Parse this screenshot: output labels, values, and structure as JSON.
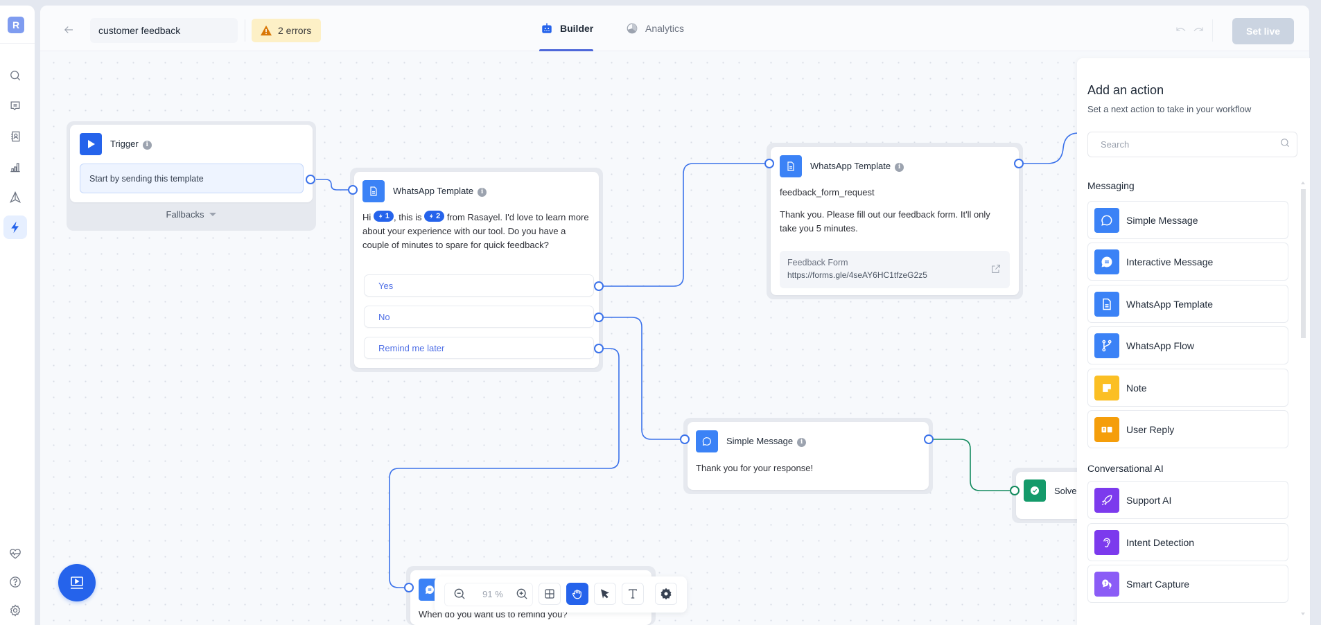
{
  "app": {
    "logo_letter": "R"
  },
  "rail": {
    "items": [
      {
        "name": "search",
        "icon": "search-icon"
      },
      {
        "name": "conversations",
        "icon": "message-square-icon"
      },
      {
        "name": "contacts",
        "icon": "contact-book-icon"
      },
      {
        "name": "reports",
        "icon": "bar-chart-icon"
      },
      {
        "name": "campaigns",
        "icon": "send-icon"
      },
      {
        "name": "automations",
        "icon": "lightning-icon",
        "active": true
      }
    ],
    "bottom_items": [
      {
        "name": "health",
        "icon": "heart-pulse-icon"
      },
      {
        "name": "help",
        "icon": "help-circle-icon"
      },
      {
        "name": "settings",
        "icon": "gear-icon"
      }
    ]
  },
  "header": {
    "workflow_name": "customer feedback",
    "errors_label": "2 errors",
    "tabs": [
      {
        "label": "Builder",
        "active": true
      },
      {
        "label": "Analytics",
        "active": false
      }
    ],
    "set_live_label": "Set live"
  },
  "nodes": {
    "trigger": {
      "title": "Trigger",
      "start_text": "Start by sending this template",
      "fallbacks_label": "Fallbacks"
    },
    "template_intro": {
      "title": "WhatsApp Template",
      "text_parts": [
        "Hi ",
        ", this is ",
        " from Rasayel. I'd love to learn more about your experience with our tool. Do you have a couple of minutes to spare for quick feedback?"
      ],
      "vars": [
        "1",
        "2"
      ],
      "replies": [
        "Yes",
        "No",
        "Remind me later"
      ]
    },
    "template_form": {
      "title": "WhatsApp Template",
      "template_name": "feedback_form_request",
      "body": "Thank you. Please fill out our feedback form. It'll only take you 5 minutes.",
      "button_label": "Feedback Form",
      "button_url": "https://forms.gle/4seAY6HC1tfzeG2z5"
    },
    "simple_message": {
      "title": "Simple Message",
      "body": "Thank you for your response!"
    },
    "solve": {
      "title": "Solve"
    },
    "remind": {
      "body": "When do you want us to remind you?"
    }
  },
  "canvas_toolbar": {
    "zoom_level": "91 %",
    "tools": [
      "zoom-out",
      "zoom-in",
      "fit-view",
      "pan",
      "select",
      "text",
      "settings"
    ],
    "active_tool": "pan"
  },
  "panel": {
    "title": "Add an action",
    "subtitle": "Set a next action to take in your workflow",
    "search_placeholder": "Search",
    "sections": [
      {
        "label": "Messaging",
        "items": [
          {
            "label": "Simple Message",
            "icon": "chat-bubble-icon",
            "color": "#3b82f6"
          },
          {
            "label": "Interactive Message",
            "icon": "chat-interactive-icon",
            "color": "#3b82f6"
          },
          {
            "label": "WhatsApp Template",
            "icon": "document-icon",
            "color": "#3b82f6"
          },
          {
            "label": "WhatsApp Flow",
            "icon": "git-branch-icon",
            "color": "#3b82f6"
          },
          {
            "label": "Note",
            "icon": "sticky-note-icon",
            "color": "#fbbf24"
          },
          {
            "label": "User Reply",
            "icon": "user-reply-icon",
            "color": "#f59e0b"
          }
        ]
      },
      {
        "label": "Conversational AI",
        "items": [
          {
            "label": "Support AI",
            "icon": "rocket-icon",
            "color": "#7c3aed"
          },
          {
            "label": "Intent Detection",
            "icon": "ear-icon",
            "color": "#7c3aed"
          },
          {
            "label": "Smart Capture",
            "icon": "smart-capture-icon",
            "color": "#8b5cf6"
          }
        ]
      }
    ]
  }
}
